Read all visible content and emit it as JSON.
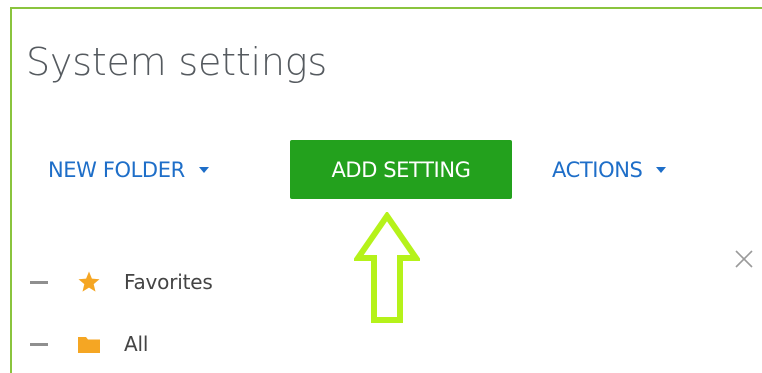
{
  "header": {
    "title": "System settings"
  },
  "toolbar": {
    "new_folder_label": "NEW FOLDER",
    "add_setting_label": "ADD SETTING",
    "actions_label": "ACTIONS"
  },
  "tree": {
    "items": [
      {
        "label": "Favorites",
        "icon": "star-icon"
      },
      {
        "label": "All",
        "icon": "folder-icon"
      }
    ]
  },
  "colors": {
    "accent_blue": "#1e6ec8",
    "add_button_green": "#23a11d",
    "frame_border": "#8ac43d",
    "annotation_arrow": "#b5f21a",
    "star_orange": "#f5a623",
    "folder_orange": "#f5a623"
  },
  "icons": {
    "close": "close-icon",
    "dropdown": "caret-down-icon",
    "annotation": "up-arrow-icon"
  }
}
